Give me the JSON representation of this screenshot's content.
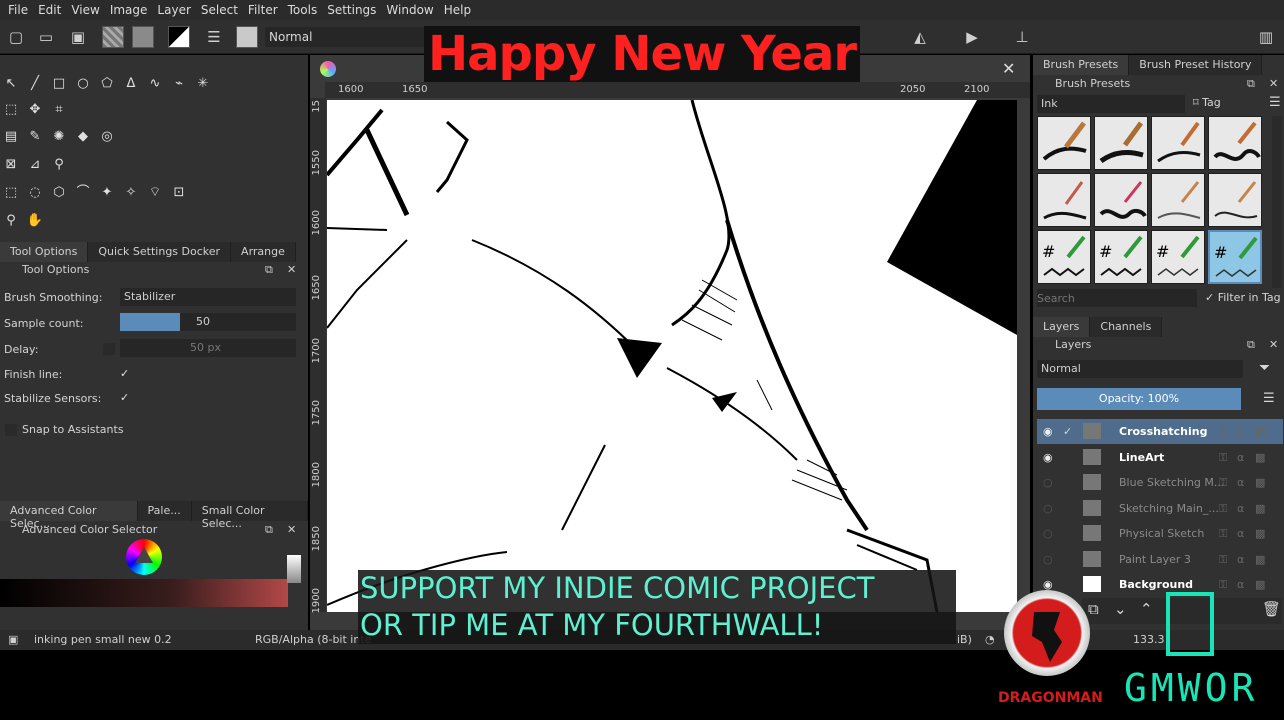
{
  "menubar": [
    "File",
    "Edit",
    "View",
    "Image",
    "Layer",
    "Select",
    "Filter",
    "Tools",
    "Settings",
    "Window",
    "Help"
  ],
  "toolbar": {
    "blend_mode": "Normal"
  },
  "overlays": {
    "banner": "Happy New Year",
    "support_line1": "SUPPORT MY INDIE COMIC PROJECT",
    "support_line2": "OR TIP ME AT MY FOURTHWALL!",
    "logo_left": "DRAGONMAN",
    "logo_right": "GMWOR"
  },
  "left_tabs": [
    "Tool Options",
    "Quick Settings Docker",
    "Arrange"
  ],
  "tool_options": {
    "title": "Tool Options",
    "brush_smoothing_label": "Brush Smoothing:",
    "brush_smoothing_value": "Stabilizer",
    "sample_count_label": "Sample count:",
    "sample_count_value": "50",
    "delay_label": "Delay:",
    "delay_value": "50 px",
    "finish_line_label": "Finish line:",
    "stabilize_sensors_label": "Stabilize Sensors:",
    "snap_label": "Snap to Assistants"
  },
  "color_tabs": [
    "Advanced Color Selec...",
    "Pale...",
    "Small Color Selec..."
  ],
  "color_panel_title": "Advanced Color Selector",
  "ruler_top": [
    "1600",
    "1650",
    "2050",
    "2100"
  ],
  "ruler_left": [
    "15",
    "1550",
    "1600",
    "1650",
    "1700",
    "1750",
    "1800",
    "1850",
    "1900"
  ],
  "right_tabs_top": [
    "Brush Presets",
    "Brush Preset History"
  ],
  "brush_presets": {
    "title": "Brush Presets",
    "tag_value": "Ink",
    "tag_label": "Tag",
    "search_placeholder": "Search",
    "filter_label": "Filter in Tag"
  },
  "layer_tabs": [
    "Layers",
    "Channels"
  ],
  "layers_panel": {
    "title": "Layers",
    "blend": "Normal",
    "opacity": "Opacity:  100%",
    "layers": [
      {
        "name": "Crosshatching",
        "visible": true,
        "active": true
      },
      {
        "name": "LineArt",
        "visible": true,
        "active": false
      },
      {
        "name": "Blue Sketching M...",
        "visible": false,
        "active": false
      },
      {
        "name": "Sketching Main_...",
        "visible": false,
        "active": false
      },
      {
        "name": "Physical Sketch",
        "visible": false,
        "active": false
      },
      {
        "name": "Paint Layer 3",
        "visible": false,
        "active": false
      },
      {
        "name": "Background",
        "visible": true,
        "active": false
      }
    ]
  },
  "status": {
    "brush": "inking pen small new 0.2",
    "color_model": "RGB/Alpha (8-bit inte",
    "size_frag": "iB)",
    "zoom": "133.3"
  },
  "colors": {
    "accent": "#5b8bb8",
    "banner_red": "#ff2020",
    "support_teal": "#5ef0d0"
  }
}
